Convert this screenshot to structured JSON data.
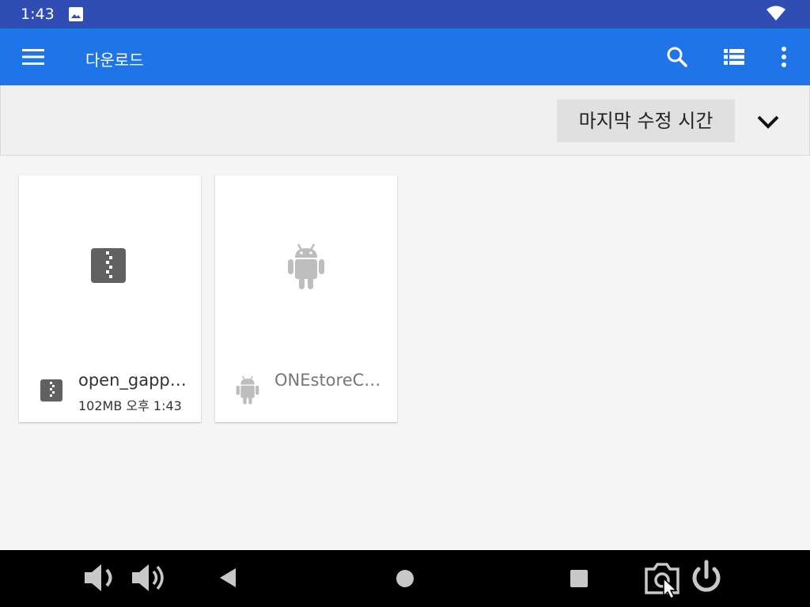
{
  "status_bar": {
    "time": "1:43"
  },
  "app_bar": {
    "title": "다운로드"
  },
  "sort": {
    "label": "마지막 수정 시간"
  },
  "files": [
    {
      "name": "open_gapp…",
      "meta": "102MB 오후 1:43",
      "icon": "zip-file-icon"
    },
    {
      "name": "ONEstoreC…",
      "meta": "",
      "icon": "android-icon"
    }
  ],
  "colors": {
    "status_bar": "#2f4db3",
    "app_bar": "#1f74e8",
    "nav_bar": "#000000",
    "zip_icon": "#616161",
    "android_icon": "#bdbdbd"
  }
}
